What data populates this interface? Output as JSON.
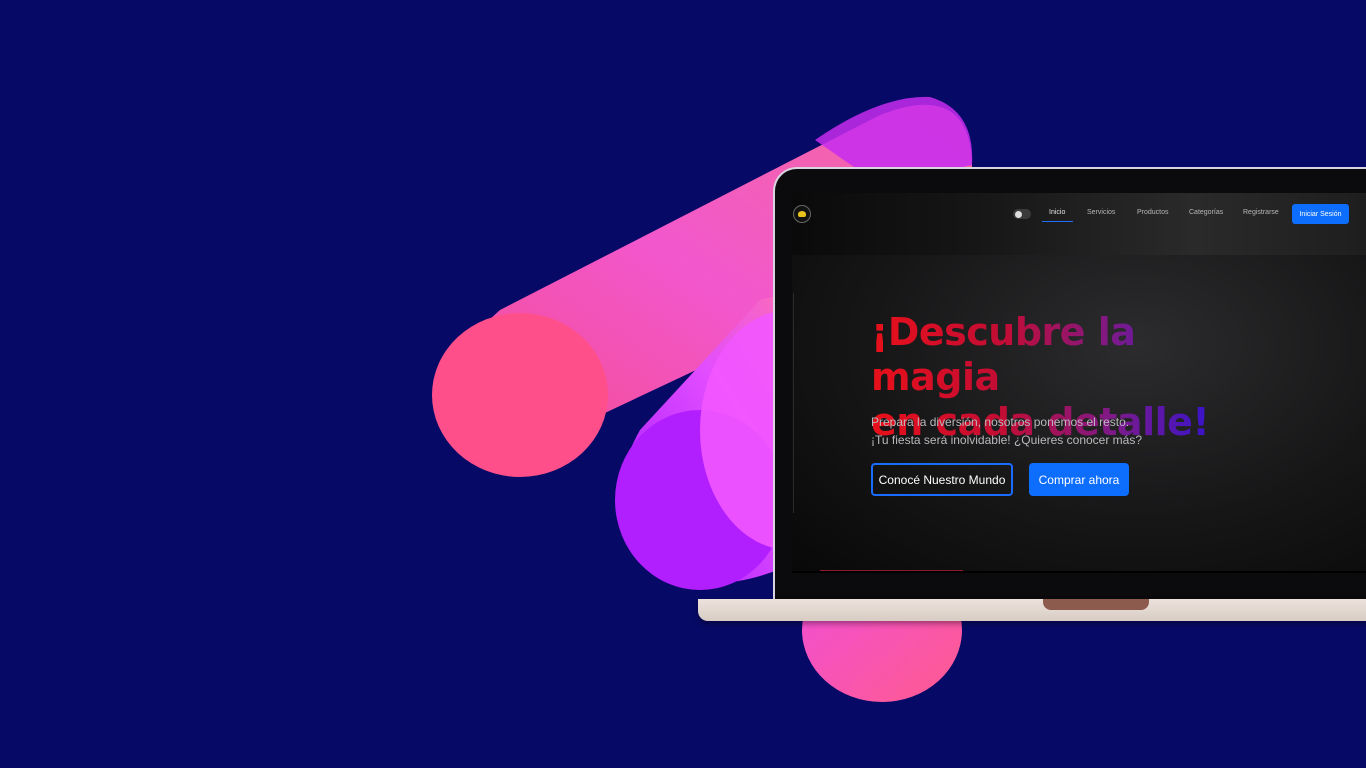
{
  "brand": {
    "colors": {
      "background": "#070966",
      "accent": "#0d6efd",
      "pink": "#ff4fa0",
      "purple": "#a21cff"
    }
  },
  "site": {
    "logo_icon": "party-logo-icon",
    "theme_toggle_icon": "theme-toggle-icon",
    "nav": {
      "items": [
        {
          "label": "Inicio",
          "active": true
        },
        {
          "label": "Servicios"
        },
        {
          "label": "Productos"
        },
        {
          "label": "Categorías"
        },
        {
          "label": "Registrarse"
        }
      ],
      "login_label": "Iniciar Sesión"
    },
    "hero": {
      "title_line1": "¡Descubre la magia",
      "title_line2": "en cada detalle!",
      "subtitle_line1": "Prepara la diversión, nosotros ponemos el resto.",
      "subtitle_line2": "¡Tu fiesta será inolvidable! ¿Quieres conocer más?",
      "cta_secondary": "Conocé Nuestro Mundo",
      "cta_primary": "Comprar ahora"
    }
  }
}
